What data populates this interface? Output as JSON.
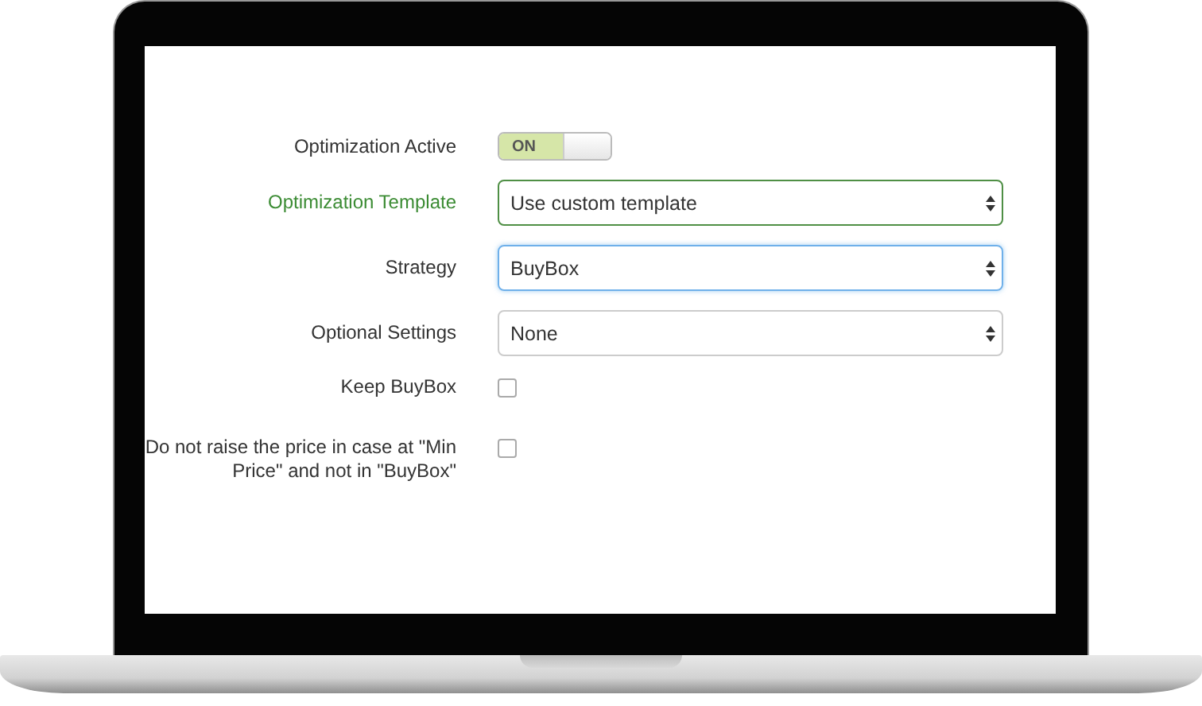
{
  "form": {
    "fields": [
      {
        "kind": "toggle",
        "label": "Optimization Active",
        "on": true,
        "value": "ON"
      },
      {
        "kind": "select",
        "label": "Optimization Template",
        "value": "Use custom template",
        "valid": true,
        "focused": false
      },
      {
        "kind": "select",
        "label": "Strategy",
        "value": "BuyBox",
        "valid": false,
        "focused": true
      },
      {
        "kind": "select",
        "label": "Optional Settings",
        "value": "None",
        "valid": false,
        "focused": false
      },
      {
        "kind": "checkbox",
        "label": "Keep BuyBox",
        "checked": false
      },
      {
        "kind": "checkbox",
        "label": "Do not raise the price in case at \"Min Price\" and not in \"BuyBox\"",
        "checked": false
      }
    ]
  }
}
